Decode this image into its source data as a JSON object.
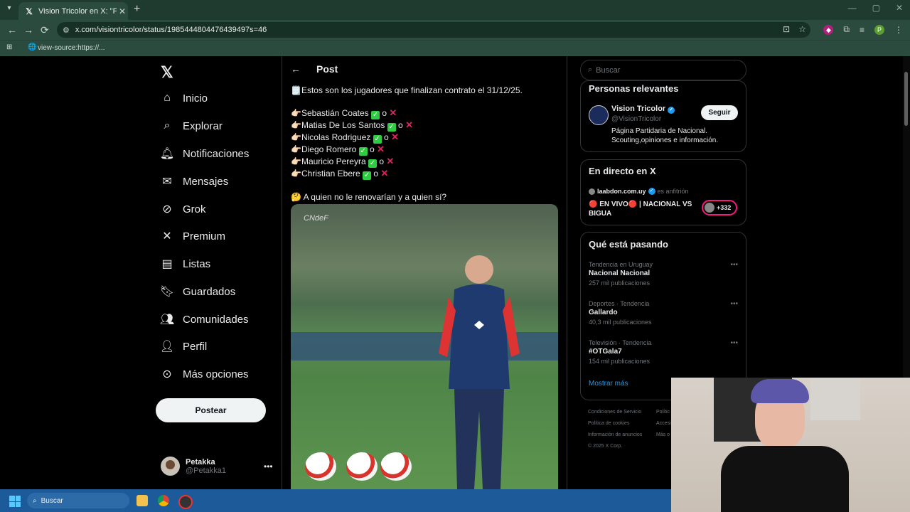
{
  "browser": {
    "tab_title": "Vision Tricolor en X: \"FINALIZA",
    "url": "x.com/visiontricolor/status/1985444804476439497s=46",
    "bookmark": "view-source:https://..."
  },
  "sidebar": {
    "nav": [
      {
        "label": "Inicio",
        "icon": "home-icon"
      },
      {
        "label": "Explorar",
        "icon": "search-icon"
      },
      {
        "label": "Notificaciones",
        "icon": "bell-icon"
      },
      {
        "label": "Mensajes",
        "icon": "mail-icon"
      },
      {
        "label": "Grok",
        "icon": "grok-icon"
      },
      {
        "label": "Premium",
        "icon": "x-icon"
      },
      {
        "label": "Listas",
        "icon": "list-icon"
      },
      {
        "label": "Guardados",
        "icon": "bookmark-icon"
      },
      {
        "label": "Comunidades",
        "icon": "people-icon"
      },
      {
        "label": "Perfil",
        "icon": "person-icon"
      },
      {
        "label": "Más opciones",
        "icon": "more-circle-icon"
      }
    ],
    "post_button": "Postear",
    "profile": {
      "name": "Petakka",
      "handle": "@Petakka1"
    }
  },
  "post": {
    "header": "Post",
    "intro": "Estos son los jugadores que finalizan contrato el 31/12/25.",
    "players": [
      "Sebastián Coates",
      "Matias De Los Santos",
      "Nicolas Rodriguez",
      "Diego Romero",
      "Mauricio Pereyra",
      "Christian Ebere"
    ],
    "separator": "o",
    "question": "A quien no le renovarían y a quien sí?",
    "watermark": "CNdeF"
  },
  "right": {
    "search_placeholder": "Buscar",
    "relevant": {
      "title": "Personas relevantes",
      "name": "Vision Tricolor",
      "handle": "@VisionTricolor",
      "bio": "Página Partidaria de Nacional. Scouting,opiniones e información.",
      "follow": "Seguir"
    },
    "live": {
      "title": "En directo en X",
      "host": "laabdon.com.uy",
      "host_suffix": "es anfitrión",
      "text": "🔴 EN VIVO🔴 | NACIONAL VS BIGUA",
      "count": "+332"
    },
    "trends": {
      "title": "Qué está pasando",
      "items": [
        {
          "category": "Tendencia en Uruguay",
          "name": "Nacional Nacional",
          "count": "257 mil publicaciones"
        },
        {
          "category": "Deportes · Tendencia",
          "name": "Gallardo",
          "count": "40,3 mil publicaciones"
        },
        {
          "category": "Televisión · Tendencia",
          "name": "#OTGala7",
          "count": "154 mil publicaciones"
        }
      ],
      "show_more": "Mostrar más"
    },
    "footer": [
      "Condiciones de Servicio",
      "Política de cookies",
      "Información de anuncios",
      "© 2025 X Corp."
    ],
    "footer_short": [
      "Polític",
      "Accesibili",
      "Más o"
    ]
  },
  "taskbar": {
    "search": "Buscar"
  }
}
